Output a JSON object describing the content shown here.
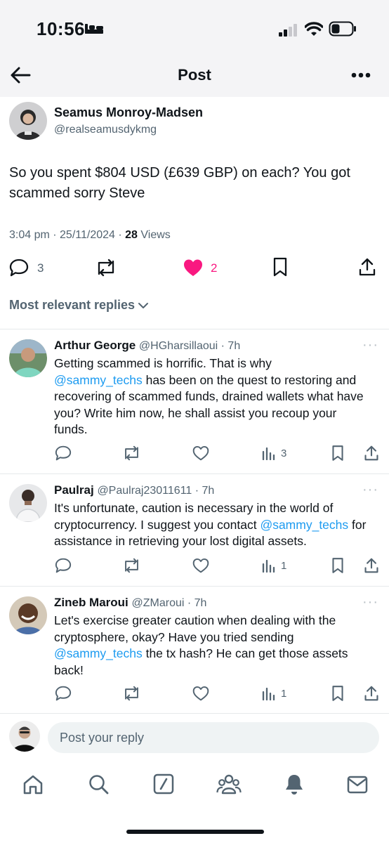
{
  "status_bar": {
    "time": "10:56"
  },
  "header": {
    "title": "Post"
  },
  "main_post": {
    "author_name": "Seamus Monroy-Madsen",
    "author_handle": "@realseamusdykmg",
    "text": "So you spent $804 USD (£639 GBP) on each? You got scammed sorry Steve",
    "timestamp": "3:04 pm · 25/11/2024 · ",
    "views_count": "28",
    "views_label": " Views",
    "replies": "3",
    "likes": "2"
  },
  "replies_section": {
    "label": "Most relevant replies"
  },
  "replies": [
    {
      "name": "Arthur George",
      "handle": "@HGharsillaoui · 7h",
      "text_before": "Getting scammed is horrific. That is why",
      "mention": "@sammy_techs",
      "text_after": " has been on the quest to restoring and recovering of scammed funds, drained wallets what have you? Write him now, he shall assist you recoup your funds.",
      "views": "3"
    },
    {
      "name": "Paulraj",
      "handle": "@Paulraj23011611 · 7h",
      "text_before": "It's unfortunate, caution is necessary in the world of cryptocurrency. I suggest you contact ",
      "mention": "@sammy_techs",
      "text_after": " for assistance in retrieving your lost digital assets.",
      "views": "1"
    },
    {
      "name": "Zineb Maroui",
      "handle": "@ZMaroui · 7h",
      "text_before": "Let's exercise greater caution when dealing with the cryptosphere, okay? Have you tried sending ",
      "mention": "@sammy_techs",
      "text_after": " the tx hash? He can get those assets back!",
      "views": "1"
    }
  ],
  "reply_composer": {
    "placeholder": "Post your reply"
  },
  "colors": {
    "accent": "#1d9bf0",
    "like": "#f91880",
    "text": "#0f1419",
    "muted": "#536471"
  },
  "bottom_nav": [
    "home-icon",
    "search-icon",
    "grok-icon",
    "communities-icon",
    "notifications-icon",
    "messages-icon"
  ]
}
